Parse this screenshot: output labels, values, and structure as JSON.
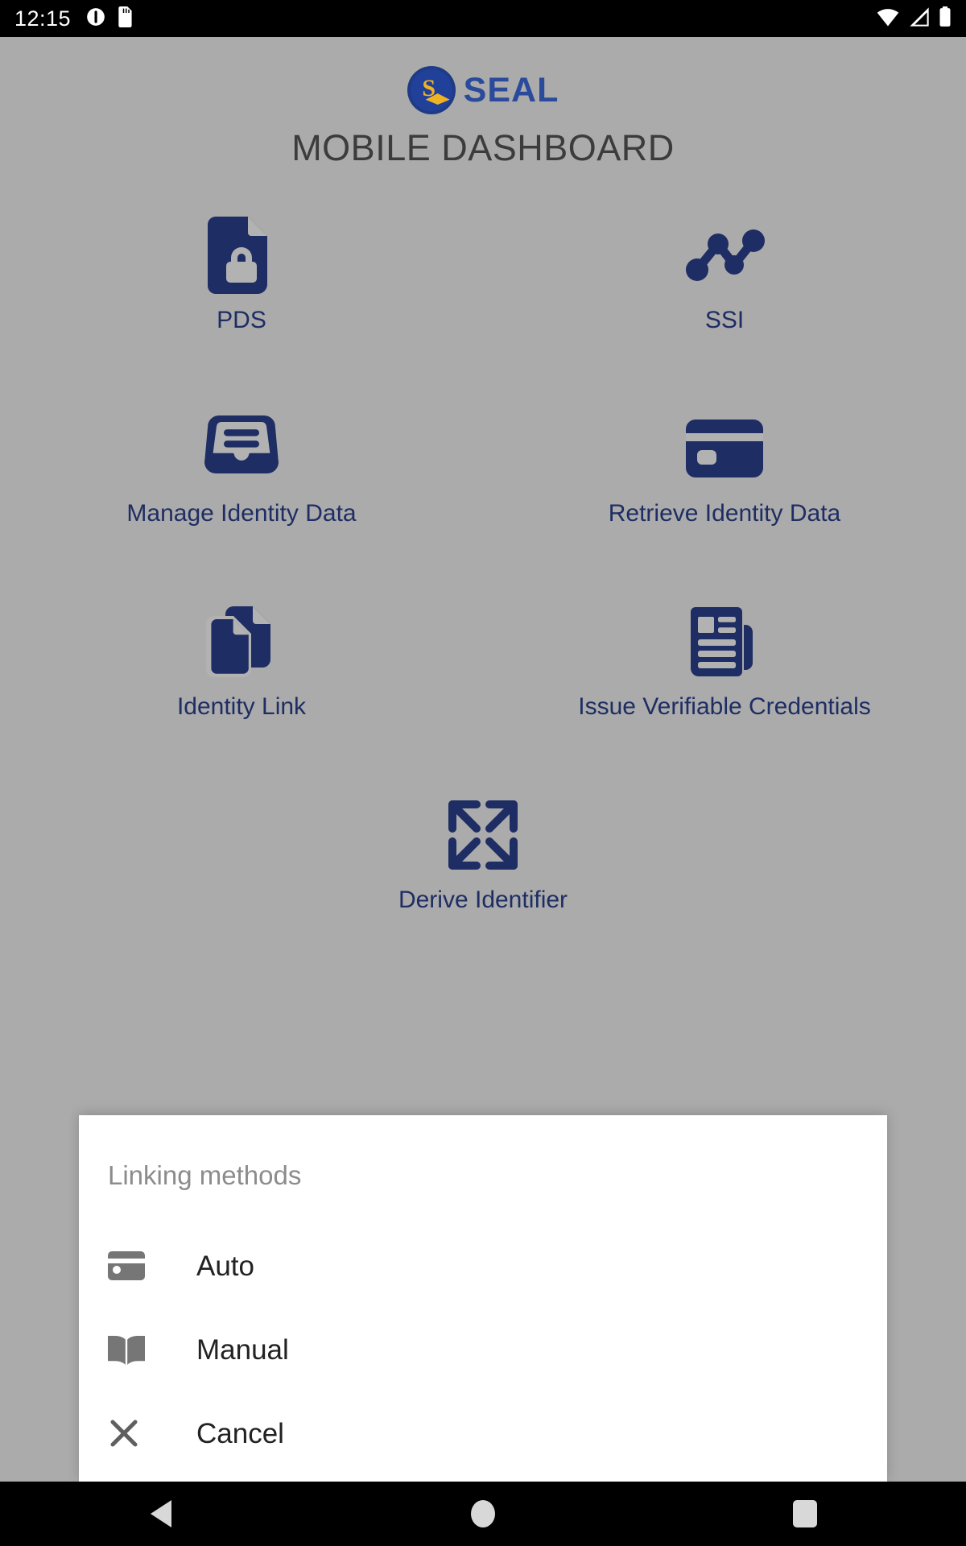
{
  "status_bar": {
    "time": "12:15",
    "left_icons": [
      "do-not-disturb-icon",
      "sd-card-icon"
    ],
    "right_icons": [
      "wifi-icon",
      "cellular-signal-icon",
      "battery-icon"
    ]
  },
  "header": {
    "brand_mark": "seal-logo-badge",
    "brand_word": "SEAL",
    "title": "MOBILE DASHBOARD"
  },
  "colors": {
    "app_background": "#ababab",
    "tile_label": "#1e2d63",
    "icon_navy": "#1e2d63",
    "brand_blue": "#2b4a9b",
    "title_gray": "#3c3c3c",
    "sheet_background": "#ffffff",
    "sheet_title_gray": "#8c8c8c",
    "sheet_icon_gray": "#767676",
    "sheet_label": "#222222",
    "nav_bar": "#000000"
  },
  "tiles": [
    {
      "label": "PDS",
      "icon": "document-lock-icon"
    },
    {
      "label": "SSI",
      "icon": "node-graph-icon"
    },
    {
      "label": "Manage Identity Data",
      "icon": "inbox-tray-icon"
    },
    {
      "label": "Retrieve Identity Data",
      "icon": "credit-card-icon"
    },
    {
      "label": "Identity Link",
      "icon": "copy-documents-icon"
    },
    {
      "label": "Issue Verifiable Credentials",
      "icon": "newspaper-icon"
    },
    {
      "label": "Derive Identifier",
      "icon": "expand-arrows-icon"
    }
  ],
  "bottom_sheet": {
    "title": "Linking methods",
    "items": [
      {
        "label": "Auto",
        "icon": "credit-card-icon"
      },
      {
        "label": "Manual",
        "icon": "open-book-icon"
      },
      {
        "label": "Cancel",
        "icon": "close-x-icon"
      }
    ]
  },
  "nav_bar": {
    "back_label": "Back",
    "home_label": "Home",
    "recents_label": "Recents"
  }
}
